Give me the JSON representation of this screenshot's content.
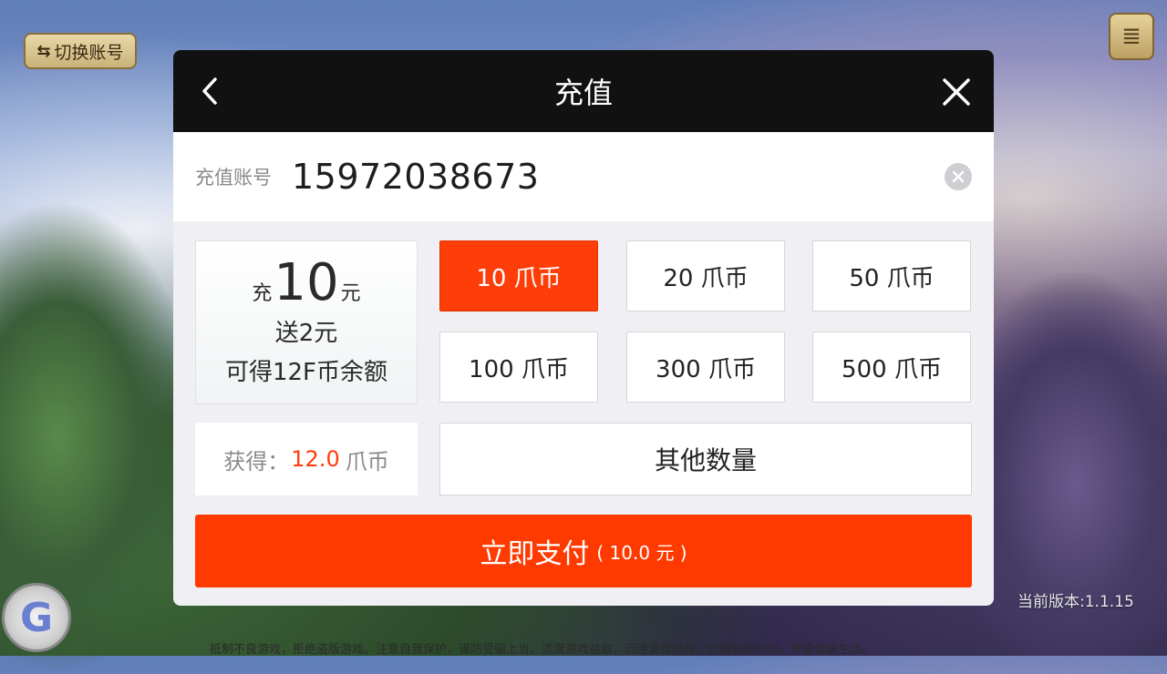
{
  "background": {
    "switch_account": "切换账号",
    "version": "当前版本:1.1.15",
    "notice": "抵制不良游戏，拒绝盗版游戏。注意自我保护，谨防受骗上当。适度游戏益脑，沉迷游戏伤身。合理安排时间，享受健康生活。"
  },
  "dialog": {
    "title": "充值",
    "account_label": "充值账号",
    "account_value": "15972038673",
    "promo": {
      "prefix": "充",
      "amount": "10",
      "unit": "元",
      "bonus": "送2元",
      "result": "可得12F币余额"
    },
    "amounts": [
      {
        "label": "10 爪币",
        "selected": true
      },
      {
        "label": "20 爪币",
        "selected": false
      },
      {
        "label": "50 爪币",
        "selected": false
      },
      {
        "label": "100 爪币",
        "selected": false
      },
      {
        "label": "300 爪币",
        "selected": false
      },
      {
        "label": "500 爪币",
        "selected": false
      }
    ],
    "gain_label": "获得：",
    "gain_value": "12.0",
    "gain_unit": "爪币",
    "other_amount": "其他数量",
    "pay_label": "立即支付",
    "pay_amount": "( 10.0 元 )"
  },
  "colors": {
    "accent": "#ff3a00",
    "header": "#121111"
  }
}
